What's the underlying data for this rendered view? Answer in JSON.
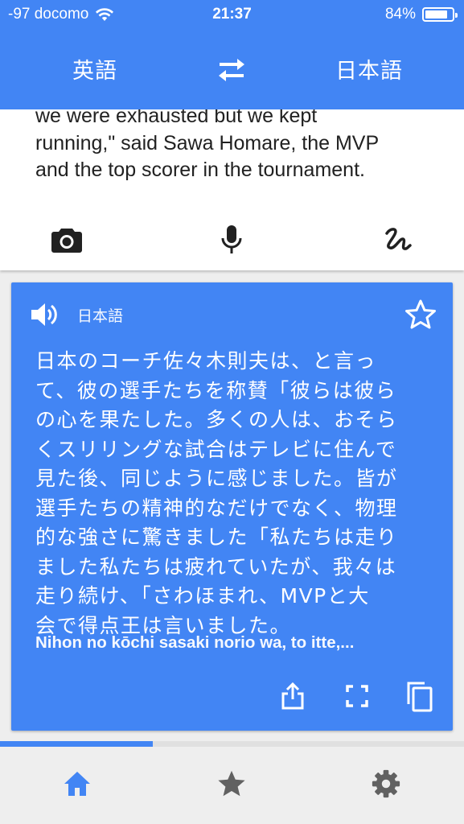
{
  "status_bar": {
    "carrier": "-97 docomo",
    "time": "21:37",
    "battery_percent": "84%",
    "battery_level": 0.84
  },
  "language_bar": {
    "source_language": "英語",
    "target_language": "日本語",
    "swap_icon": "swap-arrows-icon"
  },
  "source": {
    "lines": [
      "we were exhausted but we kept",
      "running,\" said Sawa Homare, the MVP",
      "and the top scorer in the tournament."
    ],
    "input_icons": [
      "camera-icon",
      "microphone-icon",
      "handwriting-icon"
    ]
  },
  "translation": {
    "language": "日本語",
    "lines": [
      "日本のコーチ佐々木則夫は、と言っ",
      "て、彼の選手たちを称賛「彼らは彼ら",
      "の心を果たした。多くの人は、おそら",
      "くスリリングな試合はテレビに住んで",
      "見た後、同じように感じました。皆が",
      "選手たちの精神的なだけでなく、物理",
      "的な強さに驚きました「私たちは走り",
      "ました私たちは疲れていたが、我々は",
      "走り続け、「さわほまれ、MVPと大",
      "会で得点王は言いました。"
    ],
    "romanization": "Nihon no kōchi sasaki norio wa, to itte,...",
    "actions": [
      "share-icon",
      "fullscreen-icon",
      "copy-icon"
    ]
  },
  "progress": {
    "fraction": 0.33
  },
  "bottom_nav": {
    "items": [
      "home-icon",
      "star-icon",
      "settings-icon"
    ],
    "active": "home-icon"
  },
  "colors": {
    "accent": "#4285f4",
    "nav_background": "#eeeeee",
    "inactive_icon": "#616161",
    "text_dark": "#212121"
  }
}
